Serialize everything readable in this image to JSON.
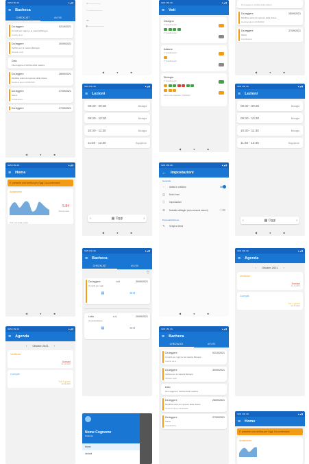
{
  "bacheca": {
    "title": "Bacheca",
    "tab_checklist": "CHECKLIST",
    "tab_avvisi": "AVVISI",
    "items": [
      {
        "title": "Da leggere",
        "date": "02/10/2021",
        "sub": "Compiti per oggi per la materia Biologia",
        "meta": "Inserito da te"
      },
      {
        "title": "Da leggere",
        "date": "30/09/2021",
        "sub": "Verifica per la materia Biologia",
        "meta": "Valutato ruolo"
      },
      {
        "title": "Dato",
        "date": "",
        "sub": "Fine leggere e Verifica della materia",
        "meta": ""
      },
      {
        "title": "Da leggere",
        "date": "28/09/2021",
        "sub": "Modifica orario di ingresso della classe",
        "meta": "Gestione alunni 2016/2020"
      },
      {
        "title": "Da leggere",
        "date": "27/09/2021",
        "sub": "Salve!",
        "meta": "Coordinatore"
      },
      {
        "title": "Da leggere",
        "date": "27/09/2021",
        "sub": "",
        "meta": ""
      }
    ]
  },
  "bacheca2": {
    "title": "Bacheca",
    "tab_checklist": "CHECKLIST",
    "tab_avvisi": "AVVISI",
    "item1_title": "Da leggere",
    "item1_n": "n.6",
    "item1_date": "30/09/2021",
    "item1_sub": "Compiti per oggi",
    "item2_title": "Letto",
    "item2_n": "n.4",
    "item2_date": "29/09/2021",
    "item2_sub": "Comunicazione"
  },
  "lezioni": {
    "title": "Lezioni",
    "rows": [
      {
        "time": "08:30 - 09:30",
        "subject": "Biologia"
      },
      {
        "time": "09:30 - 10:30",
        "subject": "Biologia"
      },
      {
        "time": "10:30 - 11:30",
        "subject": "Biologia"
      },
      {
        "time": "11:30 - 12:30",
        "subject": "Supplenze"
      }
    ],
    "today": "Oggi"
  },
  "voti": {
    "title": "Voti",
    "subjects": [
      "Disegno",
      "Italiano",
      "Biologia"
    ],
    "row_label": "1° Quadrimestre",
    "row_label2": "2° Quadrimestre",
    "footer": "Ultimo voto registrato: 27/09/2021"
  },
  "home": {
    "title": "Home",
    "banner": "E' presente una verifica per Oggi. Da confermare",
    "chart_label": "Andamento",
    "value": "5.84",
    "value_sub": "Media totale",
    "legend": "Tutti i voti (totali media)"
  },
  "impostazioni": {
    "title": "Impostazioni",
    "section_general": "Generale",
    "items": [
      "Abilita le notifiche",
      "Modo fuori",
      "Impostazioni",
      "Modalità dettaglio (solo sessioni esterni)"
    ],
    "section_prefs": "Personalizzazione",
    "pref_item": "Scegli la tema"
  },
  "agenda": {
    "title": "Agenda",
    "month": "Ottobre 2021",
    "card1_label": "Verifiche",
    "card1_value": "Domani",
    "card1_date": "01-10-2021",
    "card2_label": "Compiti",
    "card2_value": "Tra 2 giorni",
    "card2_date": "02-10-2021"
  },
  "drawer": {
    "name": "Nome Cognome",
    "role": "Studente",
    "items": [
      "Home",
      "Lezioni"
    ]
  },
  "status": {
    "carrier": "IGIN LTE 4G",
    "icons": "▲◢ ▮"
  },
  "nav": {
    "back": "◀",
    "home": "●",
    "recent": "■"
  }
}
